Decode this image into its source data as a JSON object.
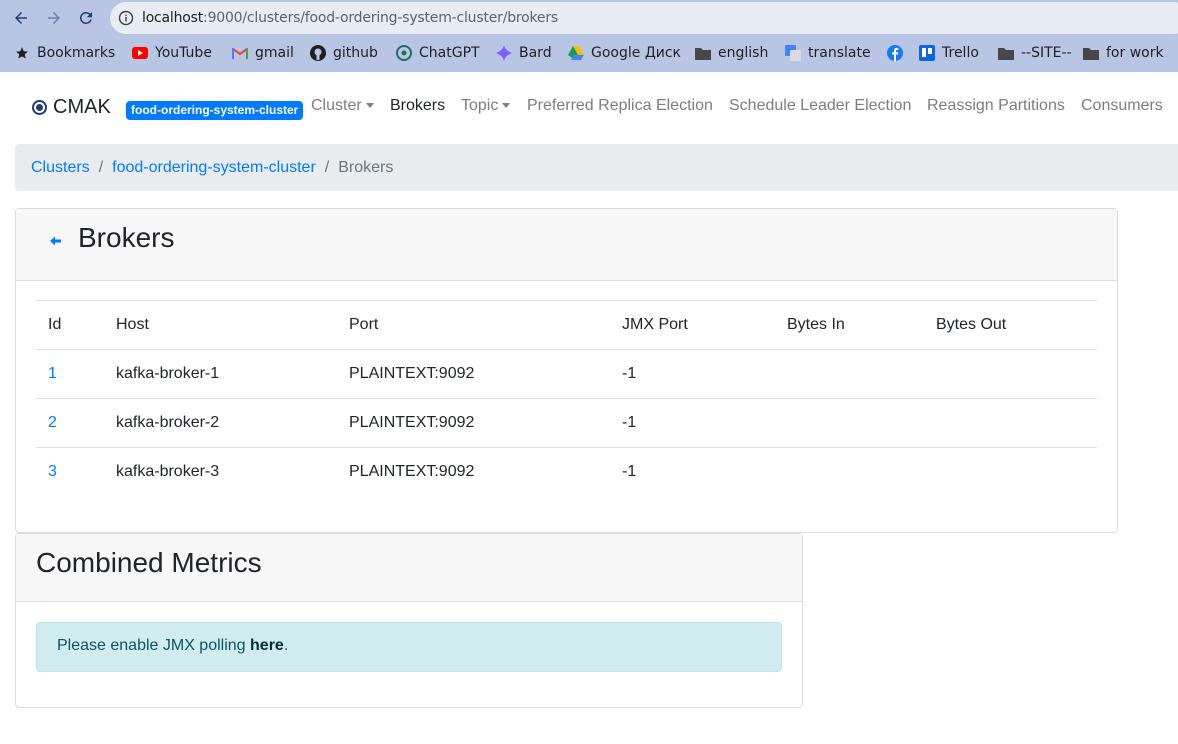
{
  "browser": {
    "url_host": "localhost",
    "url_path": ":9000/clusters/food-ordering-system-cluster/brokers",
    "bookmarks": [
      {
        "label": "Bookmarks",
        "icon": "star-icon"
      },
      {
        "label": "YouTube",
        "icon": "youtube-icon"
      },
      {
        "label": "gmail",
        "icon": "gmail-icon"
      },
      {
        "label": "github",
        "icon": "github-icon"
      },
      {
        "label": "ChatGPT",
        "icon": "chatgpt-icon"
      },
      {
        "label": "Bard",
        "icon": "bard-icon"
      },
      {
        "label": "Google Диск",
        "icon": "google-drive-icon"
      },
      {
        "label": "english",
        "icon": "folder-icon"
      },
      {
        "label": "translate",
        "icon": "google-translate-icon"
      },
      {
        "label": "",
        "icon": "facebook-icon"
      },
      {
        "label": "Trello",
        "icon": "trello-icon"
      },
      {
        "label": "--SITE--",
        "icon": "folder-icon"
      },
      {
        "label": "for work",
        "icon": "folder-icon"
      }
    ]
  },
  "navbar": {
    "brand": "CMAK",
    "cluster_badge": "food-ordering-system-cluster",
    "items": [
      {
        "label": "Cluster",
        "dropdown": true
      },
      {
        "label": "Brokers",
        "active": true
      },
      {
        "label": "Topic",
        "dropdown": true
      },
      {
        "label": "Preferred Replica Election"
      },
      {
        "label": "Schedule Leader Election"
      },
      {
        "label": "Reassign Partitions"
      },
      {
        "label": "Consumers"
      }
    ]
  },
  "breadcrumb": {
    "items": [
      "Clusters",
      "food-ordering-system-cluster",
      "Brokers"
    ],
    "separator": "/"
  },
  "brokers_card": {
    "title": "Brokers",
    "columns": [
      "Id",
      "Host",
      "Port",
      "JMX Port",
      "Bytes In",
      "Bytes Out"
    ],
    "rows": [
      {
        "id": "1",
        "host": "kafka-broker-1",
        "port": "PLAINTEXT:9092",
        "jmx_port": "-1",
        "bytes_in": "",
        "bytes_out": ""
      },
      {
        "id": "2",
        "host": "kafka-broker-2",
        "port": "PLAINTEXT:9092",
        "jmx_port": "-1",
        "bytes_in": "",
        "bytes_out": ""
      },
      {
        "id": "3",
        "host": "kafka-broker-3",
        "port": "PLAINTEXT:9092",
        "jmx_port": "-1",
        "bytes_in": "",
        "bytes_out": ""
      }
    ]
  },
  "metrics_card": {
    "title": "Combined Metrics",
    "alert_prefix": "Please enable JMX polling ",
    "alert_link": "here",
    "alert_suffix": "."
  },
  "colors": {
    "link": "#007bff",
    "badge": "#007bff",
    "chrome": "#b9c6e3",
    "alert_bg": "#d1ecf1"
  }
}
